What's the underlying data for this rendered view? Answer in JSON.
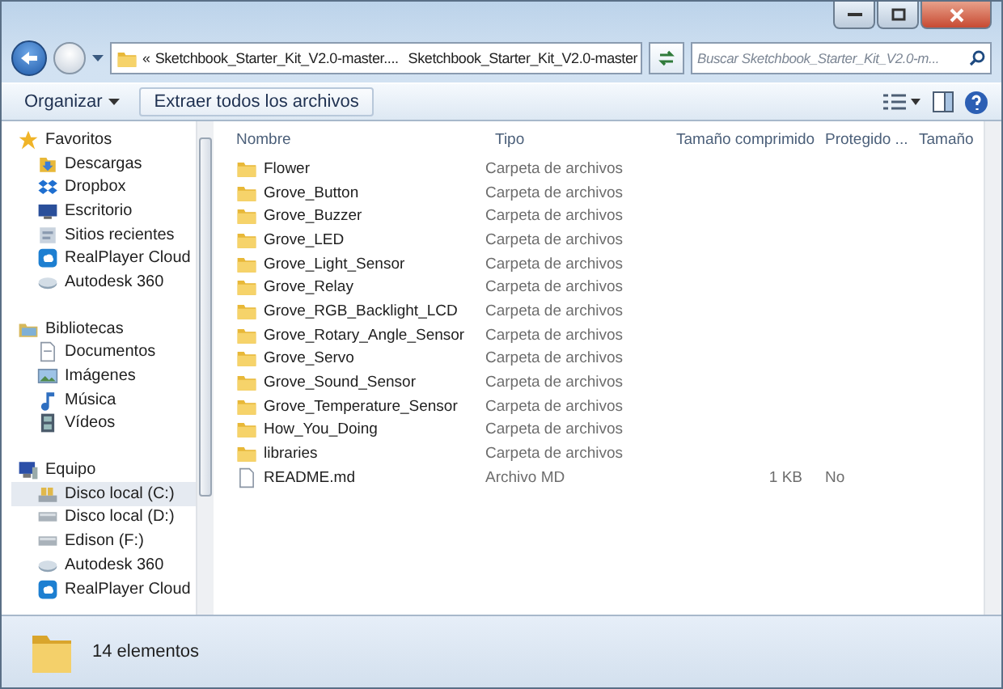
{
  "address": {
    "crumbs": [
      "«",
      "Sketchbook_Starter_Kit_V2.0-master....",
      "Sketchbook_Starter_Kit_V2.0-master"
    ]
  },
  "search": {
    "placeholder": "Buscar Sketchbook_Starter_Kit_V2.0-m..."
  },
  "toolbar": {
    "organize": "Organizar",
    "extract": "Extraer todos los archivos"
  },
  "sidebar": {
    "groups": [
      {
        "label": "Favoritos",
        "kind": "star",
        "items": [
          {
            "label": "Descargas",
            "kind": "download",
            "selected": false
          },
          {
            "label": "Dropbox",
            "kind": "dropbox",
            "selected": false
          },
          {
            "label": "Escritorio",
            "kind": "desktop",
            "selected": false
          },
          {
            "label": "Sitios recientes",
            "kind": "recent",
            "selected": false
          },
          {
            "label": "RealPlayer Cloud",
            "kind": "cloud",
            "selected": false
          },
          {
            "label": "Autodesk 360",
            "kind": "disc",
            "selected": false
          }
        ]
      },
      {
        "label": "Bibliotecas",
        "kind": "library",
        "items": [
          {
            "label": "Documentos",
            "kind": "document",
            "selected": false
          },
          {
            "label": "Imágenes",
            "kind": "image",
            "selected": false
          },
          {
            "label": "Música",
            "kind": "music",
            "selected": false
          },
          {
            "label": "Vídeos",
            "kind": "video",
            "selected": false
          }
        ]
      },
      {
        "label": "Equipo",
        "kind": "computer",
        "items": [
          {
            "label": "Disco local (C:)",
            "kind": "sysdrive",
            "selected": true
          },
          {
            "label": "Disco local (D:)",
            "kind": "drive",
            "selected": false
          },
          {
            "label": "Edison (F:)",
            "kind": "drive",
            "selected": false
          },
          {
            "label": "Autodesk 360",
            "kind": "disc",
            "selected": false
          },
          {
            "label": "RealPlayer Cloud",
            "kind": "cloud",
            "selected": false
          }
        ]
      }
    ]
  },
  "table": {
    "columns": [
      "Nombre",
      "Tipo",
      "Tamaño comprimido",
      "Protegido ...",
      "Tamaño"
    ],
    "rows": [
      {
        "kind": "folder",
        "cells": [
          "Flower",
          "Carpeta de archivos"
        ]
      },
      {
        "kind": "folder",
        "cells": [
          "Grove_Button",
          "Carpeta de archivos"
        ]
      },
      {
        "kind": "folder",
        "cells": [
          "Grove_Buzzer",
          "Carpeta de archivos"
        ]
      },
      {
        "kind": "folder",
        "cells": [
          "Grove_LED",
          "Carpeta de archivos"
        ]
      },
      {
        "kind": "folder",
        "cells": [
          "Grove_Light_Sensor",
          "Carpeta de archivos"
        ]
      },
      {
        "kind": "folder",
        "cells": [
          "Grove_Relay",
          "Carpeta de archivos"
        ]
      },
      {
        "kind": "folder",
        "cells": [
          "Grove_RGB_Backlight_LCD",
          "Carpeta de archivos"
        ]
      },
      {
        "kind": "folder",
        "cells": [
          "Grove_Rotary_Angle_Sensor",
          "Carpeta de archivos"
        ]
      },
      {
        "kind": "folder",
        "cells": [
          "Grove_Servo",
          "Carpeta de archivos"
        ]
      },
      {
        "kind": "folder",
        "cells": [
          "Grove_Sound_Sensor",
          "Carpeta de archivos"
        ]
      },
      {
        "kind": "folder",
        "cells": [
          "Grove_Temperature_Sensor",
          "Carpeta de archivos"
        ]
      },
      {
        "kind": "folder",
        "cells": [
          "How_You_Doing",
          "Carpeta de archivos"
        ]
      },
      {
        "kind": "folder",
        "cells": [
          "libraries",
          "Carpeta de archivos"
        ]
      },
      {
        "kind": "file",
        "cells": [
          "README.md",
          "Archivo MD",
          "1 KB",
          "No"
        ]
      }
    ]
  },
  "status_bar": {
    "count": "14 elementos"
  }
}
